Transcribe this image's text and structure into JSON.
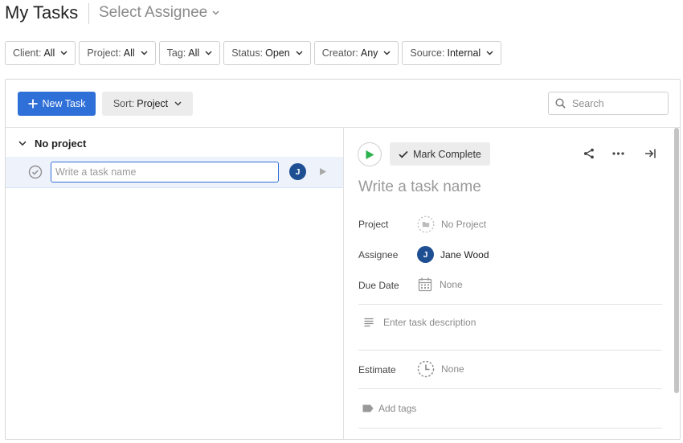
{
  "header": {
    "title": "My Tasks",
    "assignee_placeholder": "Select Assignee"
  },
  "filters": [
    {
      "label": "Client:",
      "value": "All"
    },
    {
      "label": "Project:",
      "value": "All"
    },
    {
      "label": "Tag:",
      "value": "All"
    },
    {
      "label": "Status:",
      "value": "Open"
    },
    {
      "label": "Creator:",
      "value": "Any"
    },
    {
      "label": "Source:",
      "value": "Internal"
    }
  ],
  "toolbar": {
    "new_task_label": "New Task",
    "sort_label": "Sort:",
    "sort_value": "Project",
    "search_placeholder": "Search"
  },
  "task_list": {
    "group_label": "No project",
    "row": {
      "placeholder": "Write a task name",
      "avatar_initial": "J"
    }
  },
  "detail": {
    "mark_complete_label": "Mark Complete",
    "title_placeholder": "Write a task name",
    "project_label": "Project",
    "project_value": "No Project",
    "assignee_label": "Assignee",
    "assignee_initial": "J",
    "assignee_value": "Jane Wood",
    "due_date_label": "Due Date",
    "due_date_value": "None",
    "description_placeholder": "Enter task description",
    "estimate_label": "Estimate",
    "estimate_value": "None",
    "add_tags_label": "Add tags"
  },
  "colors": {
    "primary": "#2f6fd8",
    "avatar": "#1e4f93",
    "play_green": "#2bb24c"
  }
}
